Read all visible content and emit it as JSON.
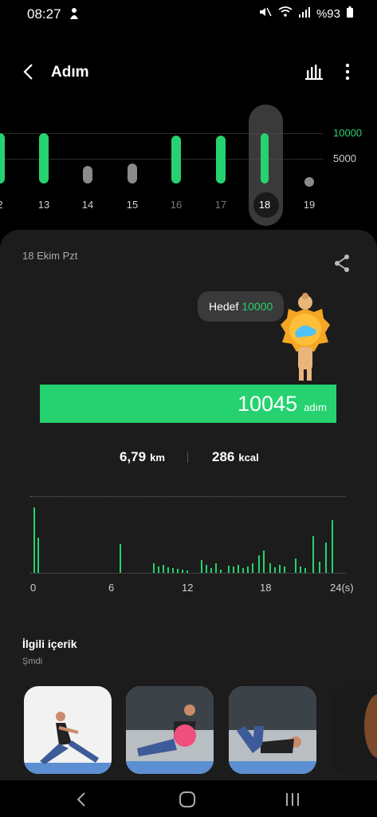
{
  "status_bar": {
    "time": "08:27",
    "battery": "%93"
  },
  "header": {
    "title": "Adım"
  },
  "weekly": {
    "goal_labels": [
      "10000",
      "5000"
    ],
    "days": [
      {
        "label": "2",
        "steps": 10000,
        "goal_met": true
      },
      {
        "label": "13",
        "steps": 10000,
        "goal_met": true
      },
      {
        "label": "14",
        "steps": 3500,
        "goal_met": false
      },
      {
        "label": "15",
        "steps": 4000,
        "goal_met": false
      },
      {
        "label": "16",
        "steps": 9500,
        "goal_met": true
      },
      {
        "label": "17",
        "steps": 9500,
        "goal_met": true
      },
      {
        "label": "18",
        "steps": 10045,
        "goal_met": true
      },
      {
        "label": "19",
        "steps": 0,
        "goal_met": false
      }
    ],
    "selected_day": "18"
  },
  "day_detail": {
    "date": "18 Ekim Pzt",
    "goal_prefix": "Hedef",
    "goal_value": "10000",
    "steps": "10045",
    "steps_unit": "adım",
    "distance": "6,79",
    "distance_unit": "km",
    "calories": "286",
    "calories_unit": "kcal"
  },
  "hourly_chart": {
    "x_ticks": [
      "0",
      "6",
      "12",
      "18",
      "24(s)"
    ]
  },
  "related": {
    "title": "İlgili içerik",
    "subtitle": "Şmdi"
  },
  "colors": {
    "accent": "#26d26f",
    "card": "#1c1c1c"
  }
}
